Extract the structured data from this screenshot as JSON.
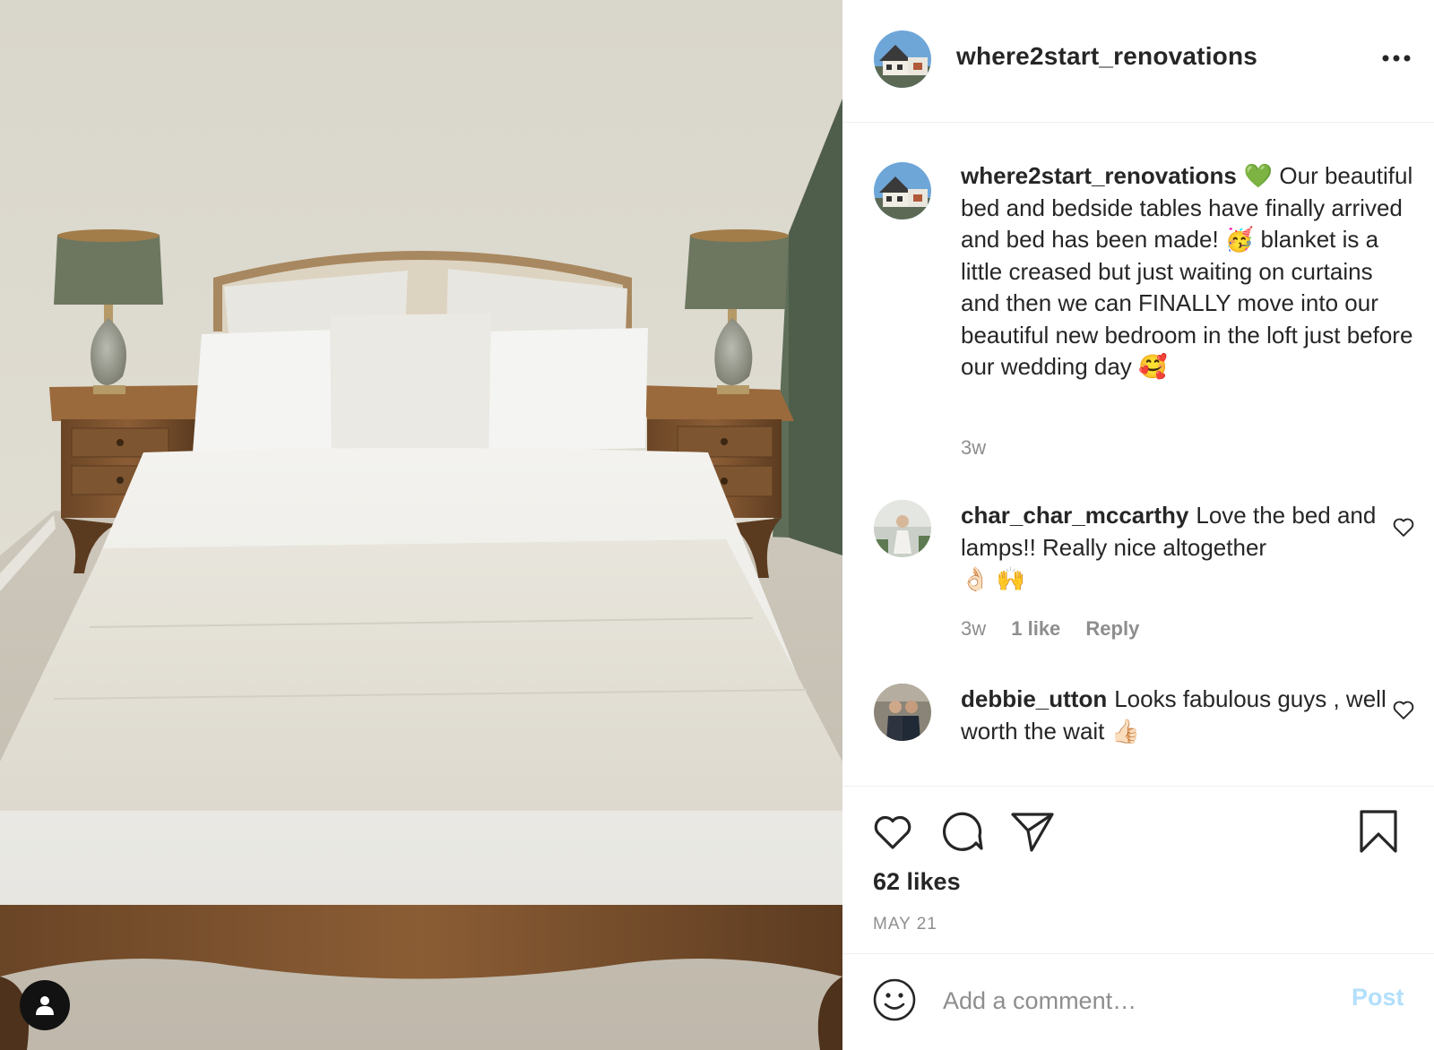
{
  "post": {
    "author": "where2start_renovations",
    "more_icon": "more-horizontal-icon",
    "more_label": "•••",
    "photo_alt": "bedroom photo"
  },
  "caption": {
    "username": "where2start_renovations",
    "emoji_1": "💚",
    "text_1": "Our beautiful bed and bedside tables have finally arrived and bed has been made!",
    "emoji_2": "🥳",
    "text_2": "blanket is a little creased but just waiting on curtains and then we can FINALLY move into our beautiful new bedroom in the loft just before our wedding day",
    "emoji_3": "🥰",
    "time": "3w"
  },
  "comments": [
    {
      "username": "char_char_mccarthy",
      "text": "Love the bed and lamps!! Really nice altogether",
      "emoji": "👌🏻 🙌",
      "time": "3w",
      "likes": "1 like",
      "reply": "Reply"
    },
    {
      "username": "debbie_utton",
      "text": "Looks fabulous guys , well worth the wait",
      "emoji": "👍🏻"
    }
  ],
  "actions": {
    "likes": "62 likes",
    "date": "MAY 21"
  },
  "comment_box": {
    "placeholder": "Add a comment…",
    "post_label": "Post"
  },
  "colors": {
    "text": "#262626",
    "muted": "#8e8e8e",
    "post_disabled": "#b2dffc",
    "divider": "#efefef"
  }
}
